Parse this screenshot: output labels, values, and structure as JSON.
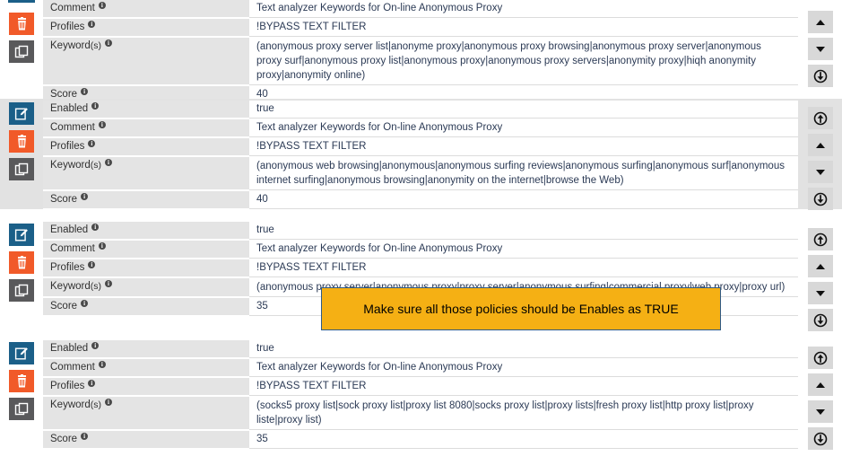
{
  "labels": {
    "enabled": "Enabled",
    "comment": "Comment",
    "profiles": "Profiles",
    "keywords_main": "Keyword",
    "keywords_sub": "(s)",
    "score": "Score",
    "info_glyph": "i"
  },
  "action_icons": {
    "edit": "edit-pencil-icon",
    "delete": "trash-icon",
    "copy": "copy-icon"
  },
  "order_icons": {
    "move_top": "move-to-top-icon",
    "move_up": "move-up-icon",
    "move_down": "move-down-icon",
    "move_bottom": "move-to-bottom-icon"
  },
  "callout": {
    "text": "Make sure all those policies should be Enables as TRUE",
    "background": "#f5b014",
    "border": "#2f5a86"
  },
  "colors": {
    "edit_button": "#1b5f88",
    "delete_button": "#f15a29",
    "copy_button": "#59595b",
    "label_background": "#e4e4e4",
    "block_tint": "#e2e2e2",
    "value_text": "#2b3a55"
  },
  "policies": [
    {
      "id": "policy-1",
      "partial_top": true,
      "enabled": null,
      "comment": "Text analyzer Keywords for On-line Anonymous Proxy",
      "profiles": "!BYPASS TEXT FILTER",
      "keywords": "(anonymous proxy server list|anonyme proxy|anonymous proxy browsing|anonymous proxy server|anonymous proxy surf|anonymous proxy list|anonymous proxy|anonymous proxy servers|anonymity proxy|hiqh anonymity proxy|anonymity online)",
      "score": "40"
    },
    {
      "id": "policy-2",
      "partial_top": false,
      "enabled": "true",
      "comment": "Text analyzer Keywords for On-line Anonymous Proxy",
      "profiles": "!BYPASS TEXT FILTER",
      "keywords": "(anonymous web browsing|anonymous|anonymous surfing reviews|anonymous surfing|anonymous surf|anonymous internet surfing|anonymous browsing|anonymity on the internet|browse the Web)",
      "score": "40"
    },
    {
      "id": "policy-3",
      "partial_top": false,
      "enabled": "true",
      "comment": "Text analyzer Keywords for On-line Anonymous Proxy",
      "profiles": "!BYPASS TEXT FILTER",
      "keywords": "(anonymous proxy server|anonymous proxy|proxy server|anonymous surfing|commercial proxy|web proxy|proxy url)",
      "score": "35"
    },
    {
      "id": "policy-4",
      "partial_top": false,
      "enabled": "true",
      "comment": "Text analyzer Keywords for On-line Anonymous Proxy",
      "profiles": "!BYPASS TEXT FILTER",
      "keywords": "(socks5 proxy list|sock proxy list|proxy list 8080|socks proxy list|proxy lists|fresh proxy list|http proxy list|proxy liste|proxy list)",
      "score": "35"
    }
  ]
}
